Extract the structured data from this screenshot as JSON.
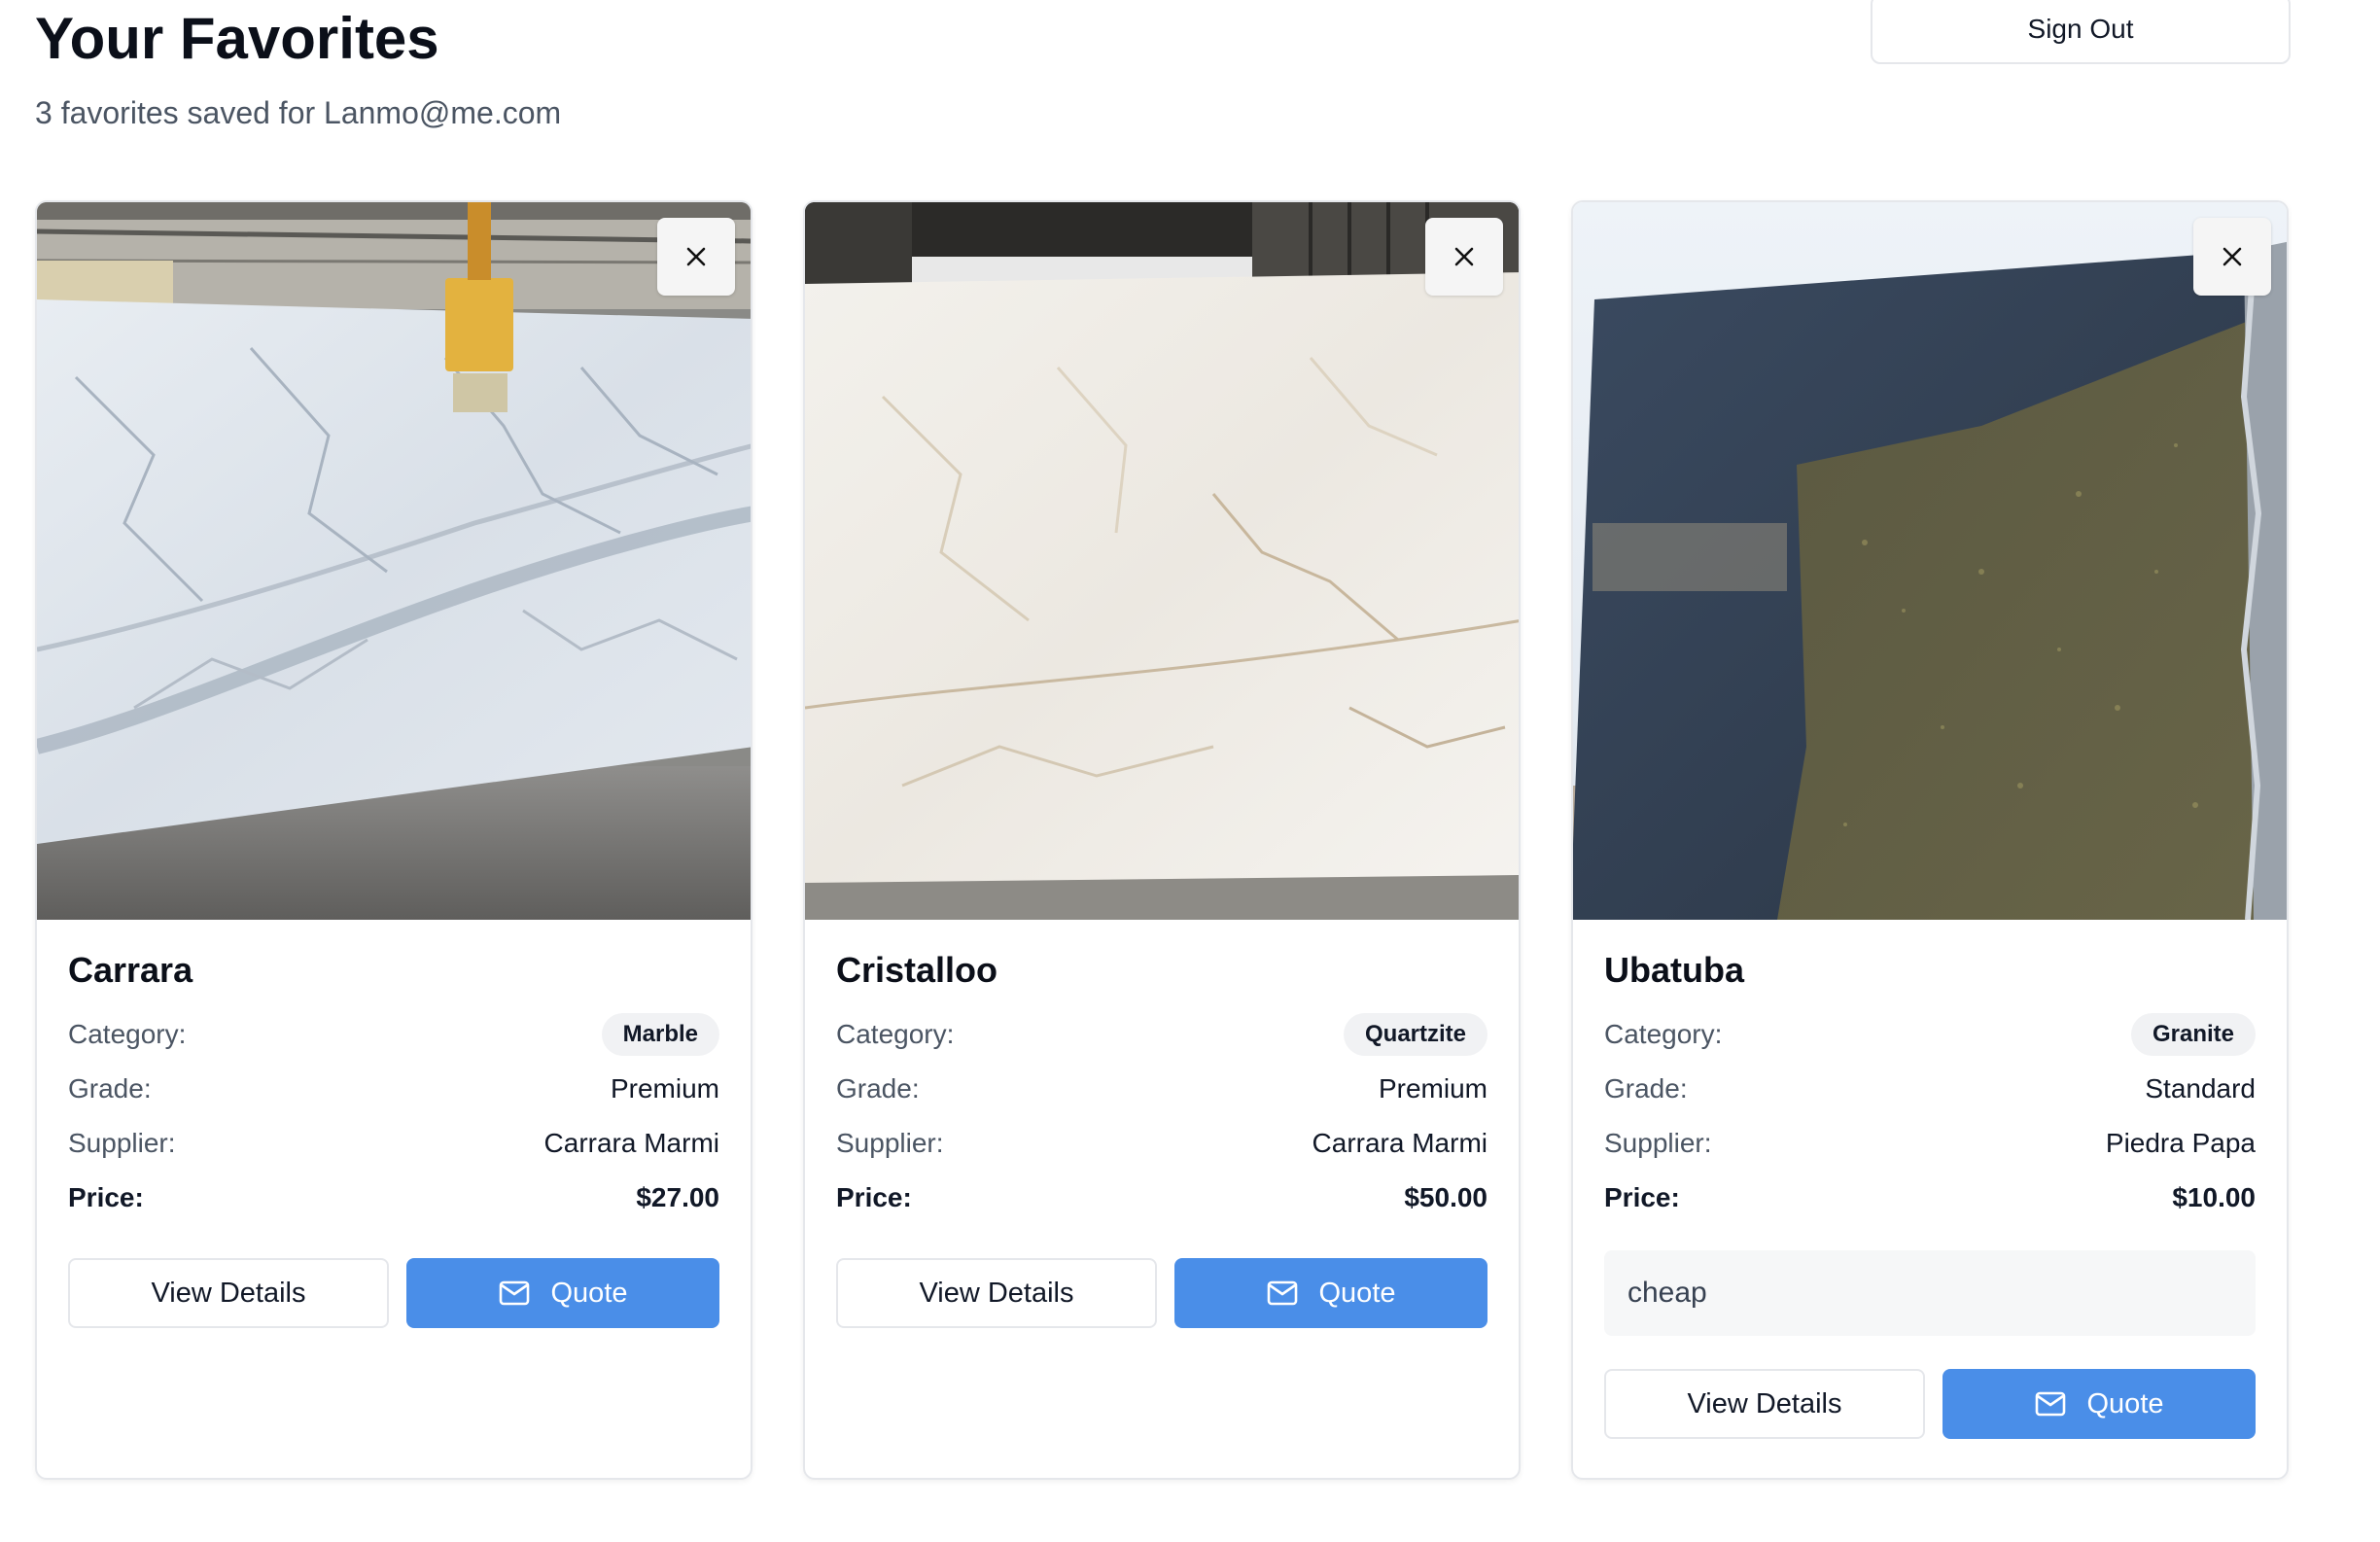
{
  "header": {
    "title": "Your Favorites",
    "subtitle": "3 favorites saved for Lanmo@me.com",
    "sign_out_label": "Sign Out"
  },
  "labels": {
    "category": "Category:",
    "grade": "Grade:",
    "supplier": "Supplier:",
    "price": "Price:",
    "view_details": "View Details",
    "quote": "Quote"
  },
  "favorites": [
    {
      "name": "Carrara",
      "category": "Marble",
      "grade": "Premium",
      "supplier": "Carrara Marmi",
      "price": "$27.00",
      "image": "white-marble-slab",
      "notes": ""
    },
    {
      "name": "Cristalloo",
      "category": "Quartzite",
      "grade": "Premium",
      "supplier": "Carrara Marmi",
      "price": "$50.00",
      "image": "white-quartzite-slab",
      "notes": ""
    },
    {
      "name": "Ubatuba",
      "category": "Granite",
      "grade": "Standard",
      "supplier": "Piedra Papa",
      "price": "$10.00",
      "image": "dark-granite-slab",
      "notes": "cheap"
    }
  ],
  "icons": {
    "remove": "close-icon",
    "quote": "mail-icon"
  },
  "colors": {
    "primary": "#4a8ee8",
    "border": "#e5e7eb",
    "badge_bg": "#f1f2f4"
  }
}
